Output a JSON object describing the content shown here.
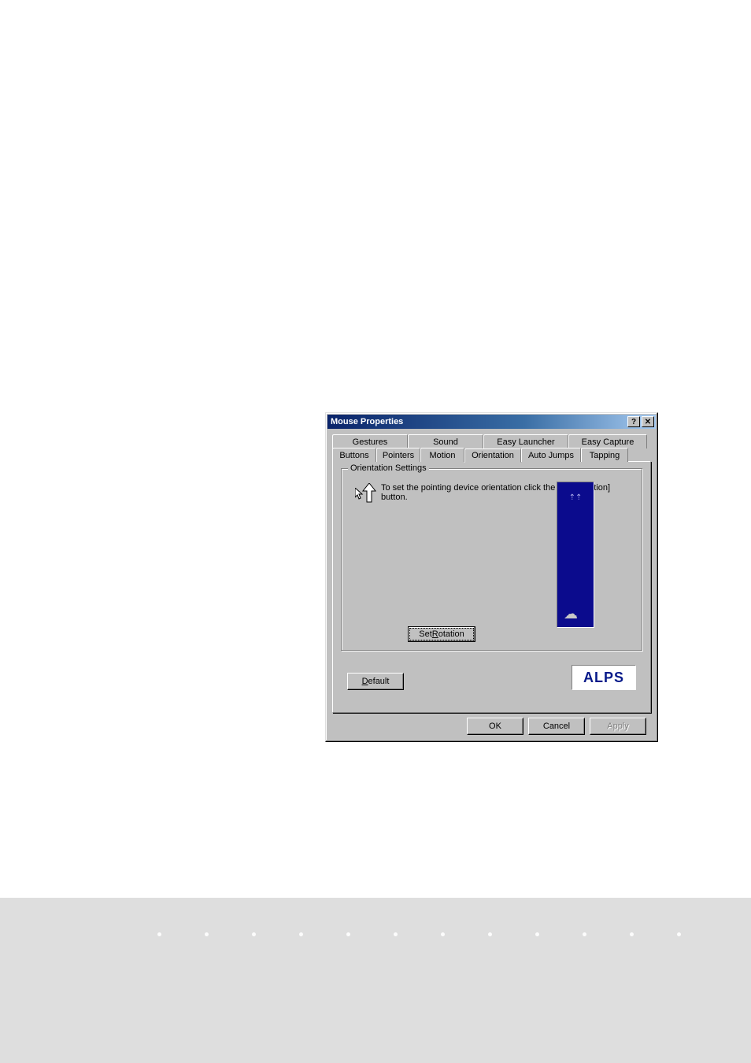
{
  "dialog": {
    "title": "Mouse Properties",
    "titlebar_buttons": {
      "help": "?",
      "close": "✕"
    }
  },
  "tabs": {
    "row1": [
      {
        "label": "Gestures"
      },
      {
        "label": "Sound"
      },
      {
        "label": "Easy Launcher"
      },
      {
        "label": "Easy Capture"
      }
    ],
    "row2": [
      {
        "label": "Buttons"
      },
      {
        "label": "Pointers"
      },
      {
        "label": "Motion"
      },
      {
        "label": "Orientation",
        "active": true
      },
      {
        "label": "Auto Jumps"
      },
      {
        "label": "Tapping"
      }
    ]
  },
  "group": {
    "legend": "Orientation Settings",
    "description": "To set the pointing device orientation click the [Set Rotation] button.",
    "set_rotation_prefix": "Set ",
    "set_rotation_uchar": "R",
    "set_rotation_suffix": "otation"
  },
  "logo": "ALPS",
  "buttons": {
    "default_uchar": "D",
    "default_suffix": "efault",
    "ok": "OK",
    "cancel": "Cancel",
    "apply_uchar": "A",
    "apply_suffix": "pply"
  }
}
